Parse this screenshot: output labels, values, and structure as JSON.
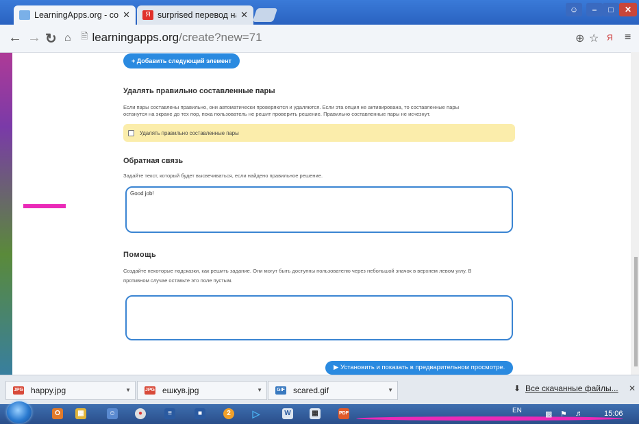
{
  "browser": {
    "tabs": [
      {
        "title": "LearningApps.org - созда",
        "close": "✕"
      },
      {
        "title": "surprised перевод на рус",
        "close": "✕"
      }
    ],
    "url_host": "learningapps.org",
    "url_path": "/create?new=71"
  },
  "page": {
    "add_button": "+ Добавить следующий элемент",
    "remove_section": {
      "title": "Удалять правильно составленные пары",
      "description_line1": "Если пары составлены правильно, они автоматически проверяются и удаляются. Если эта опция не активирована, то составленные пары",
      "description_line2": "останутся на экране до тех пор, пока пользователь не решит проверить решение. Правильно составленные пары не исчезнут.",
      "checkbox_label": "Удалять правильно составленные пары",
      "checked": false
    },
    "feedback_section": {
      "title": "Обратная связь",
      "description": "Задайте текст, который будет высвечиваться, если найдено правильное решение.",
      "value": "Good job!"
    },
    "help_section": {
      "title": "Помощь",
      "description_line1": "Создайте некоторые подсказки, как решить задание. Они могут быть доступны пользователю через небольшой значок в верхнем левом углу. В",
      "description_line2": "противном случае оставьте это поле пустым.",
      "value": ""
    },
    "preview_button": "▶ Установить и показать в предварительном просмотре."
  },
  "downloads": {
    "files": [
      {
        "name": "happy.jpg",
        "type": "JPG"
      },
      {
        "name": "ешкув.jpg",
        "type": "JPG"
      },
      {
        "name": "scared.gif",
        "type": "GIF"
      }
    ],
    "show_all": "Все скачанные файлы...",
    "close": "✕"
  },
  "taskbar": {
    "lang": "EN",
    "time": "15:06"
  },
  "colors": {
    "accent": "#2a8ae0",
    "textarea_border": "#3a84d2",
    "notice_bg": "#fbedab",
    "highlight_pink": "#ea2ab8"
  }
}
